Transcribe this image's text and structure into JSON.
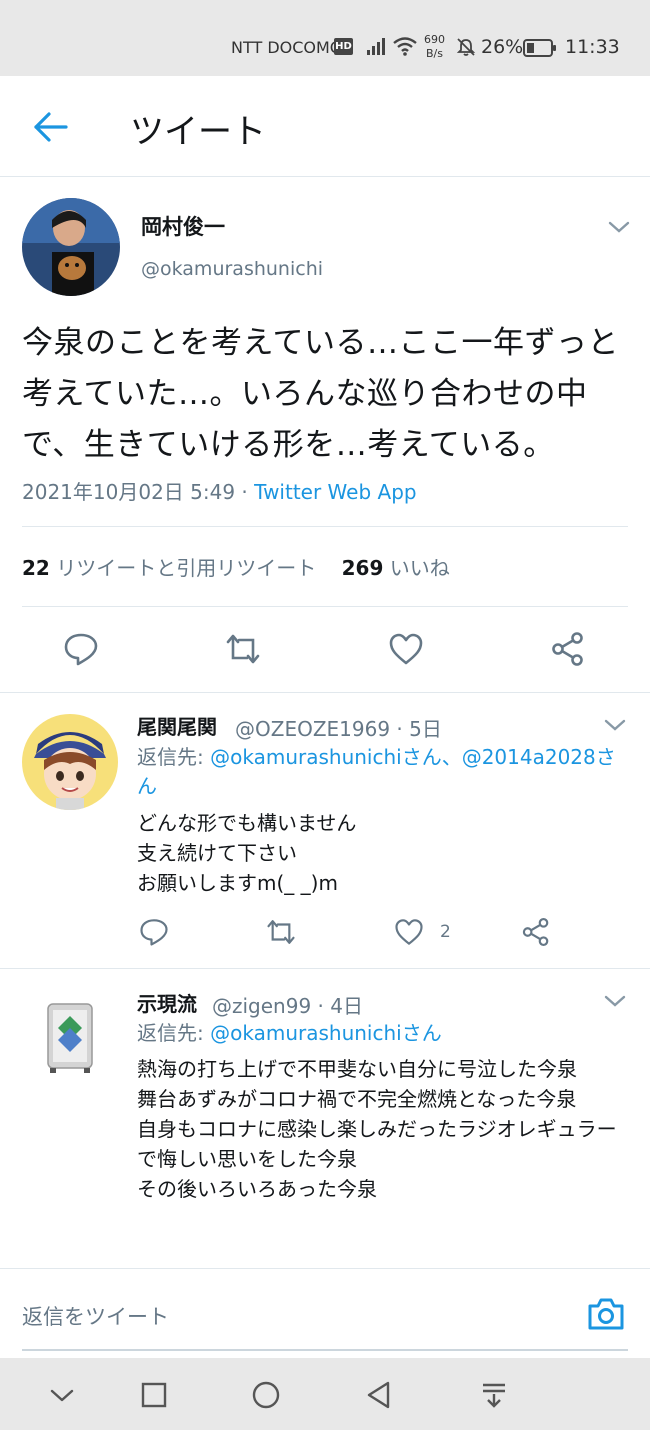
{
  "status_bar": {
    "carrier": "NTT DOCOMO",
    "hd_badge": "HD",
    "net_speed_value": "690",
    "net_speed_unit": "B/s",
    "battery_percent": "26%",
    "time": "11:33"
  },
  "header": {
    "title": "ツイート"
  },
  "tweet": {
    "author_name": "岡村俊一",
    "author_handle": "@okamurashunichi",
    "text": "今泉のことを考えている…ここ一年ずっと考えていた…。いろんな巡り合わせの中で、生きていける形を…考えている。",
    "timestamp": "2021年10月02日 5:49",
    "separator": " · ",
    "source": "Twitter Web App",
    "retweet_count": "22",
    "retweet_label": "リツイートと引用リツイート",
    "like_count": "269",
    "like_label": "いいね"
  },
  "replies": [
    {
      "name": "尾関尾関",
      "meta": "@OZEOZE1969 · 5日",
      "reply_to_label": "返信先: ",
      "reply_to_mentions": "@okamurashunichiさん、@2014a2028さん",
      "lines": [
        "どんな形でも構いません",
        "支え続けて下さい",
        "お願いしますm(_ _)m"
      ],
      "like_count": "2"
    },
    {
      "name": "示現流",
      "meta": "@zigen99 · 4日",
      "reply_to_label": "返信先: ",
      "reply_to_mentions": "@okamurashunichiさん",
      "lines": [
        "熱海の打ち上げで不甲斐ない自分に号泣した今泉",
        "舞台あずみがコロナ禍で不完全燃焼となった今泉",
        "自身もコロナに感染し楽しみだったラジオレギュラーで悔しい思いをした今泉",
        "その後いろいろあった今泉"
      ]
    }
  ],
  "compose": {
    "placeholder": "返信をツイート"
  },
  "colors": {
    "accent": "#1b95e0",
    "secondary_text": "#657786",
    "divider": "#e1e8ed"
  },
  "icons": [
    "back-arrow-icon",
    "chevron-down-icon",
    "reply-icon",
    "retweet-icon",
    "like-icon",
    "share-icon",
    "camera-icon",
    "nav-back-icon",
    "nav-home-icon",
    "nav-recents-icon",
    "nav-down-icon",
    "nav-notification-icon"
  ]
}
